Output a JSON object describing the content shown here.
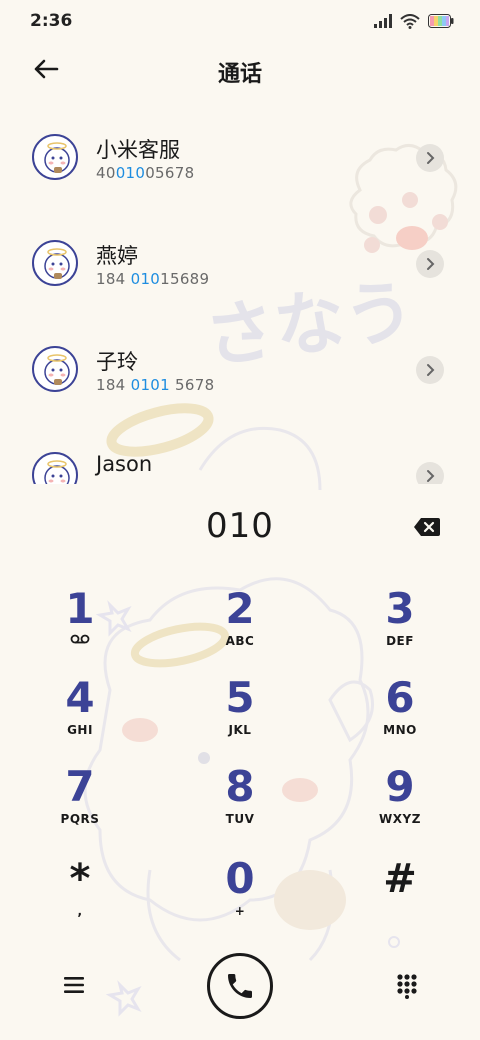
{
  "status_bar": {
    "time": "2:36"
  },
  "header": {
    "title": "通话"
  },
  "contacts": [
    {
      "name": "小米客服",
      "number_pre": "40",
      "number_hl": "010",
      "number_post": "05678"
    },
    {
      "name": "燕婷",
      "number_pre": "184 ",
      "number_hl": "010",
      "number_post": "15689"
    },
    {
      "name": "子玲",
      "number_pre": "184 ",
      "number_hl": "0101",
      "number_post": " 5678"
    },
    {
      "name": "Jason",
      "number_pre": "",
      "number_hl": "",
      "number_post": ""
    }
  ],
  "dialer": {
    "dialed_number": "010"
  },
  "keys": [
    {
      "digit": "1",
      "letters": ""
    },
    {
      "digit": "2",
      "letters": "ABC"
    },
    {
      "digit": "3",
      "letters": "DEF"
    },
    {
      "digit": "4",
      "letters": "GHI"
    },
    {
      "digit": "5",
      "letters": "JKL"
    },
    {
      "digit": "6",
      "letters": "MNO"
    },
    {
      "digit": "7",
      "letters": "PQRS"
    },
    {
      "digit": "8",
      "letters": "TUV"
    },
    {
      "digit": "9",
      "letters": "WXYZ"
    },
    {
      "digit": "*",
      "letters": ","
    },
    {
      "digit": "0",
      "letters": "+"
    },
    {
      "digit": "#",
      "letters": ""
    }
  ],
  "icons": {
    "key1_sub": "voicemail-icon",
    "back": "back-arrow-icon",
    "backspace": "backspace-icon",
    "menu": "menu-icon",
    "call": "phone-icon",
    "keypad": "dialpad-icon",
    "chevron": "chevron-right-icon"
  },
  "colors": {
    "background": "#fbf8f1",
    "digit": "#3c4396",
    "highlight": "#1e8de0",
    "text": "#1a1a1a"
  }
}
